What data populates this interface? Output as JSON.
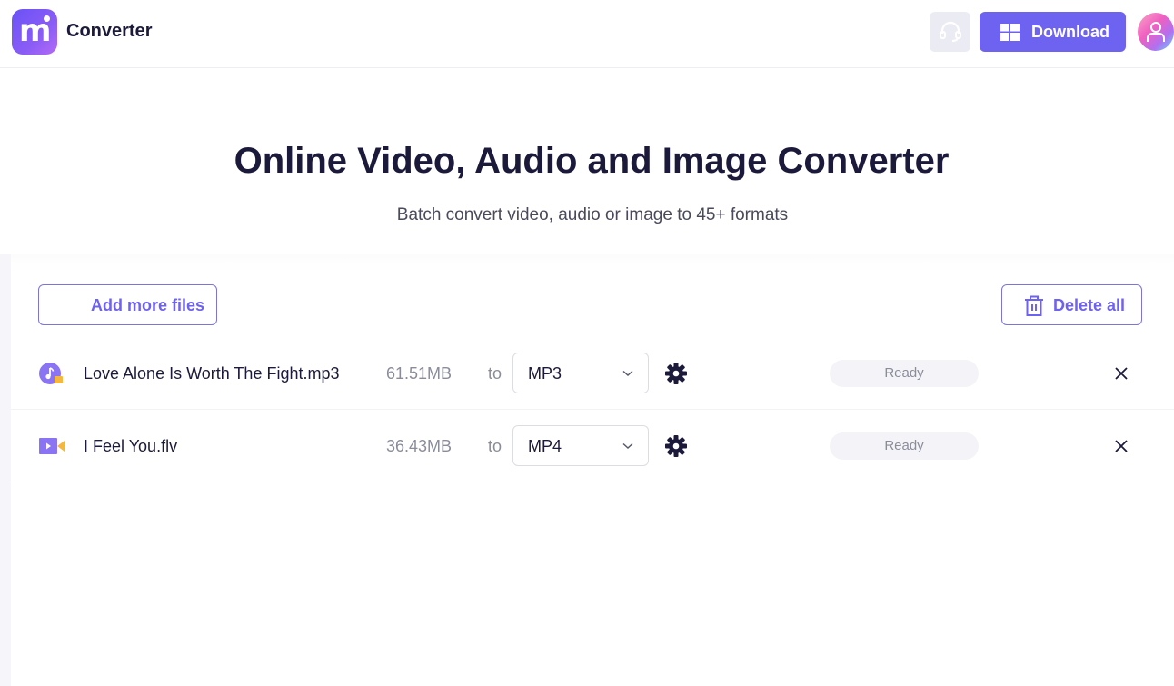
{
  "header": {
    "app_name": "Converter",
    "logo_letter": "m",
    "download_label": "Download",
    "support_icon": "headset-icon",
    "download_icon": "windows-icon",
    "avatar_icon": "user-icon"
  },
  "hero": {
    "title": "Online Video, Audio and Image Converter",
    "subtitle": "Batch convert video, audio or image to 45+ formats"
  },
  "toolbar": {
    "add_label": "Add more files",
    "delete_label": "Delete all",
    "delete_icon": "trash-icon"
  },
  "files": [
    {
      "name": "Love Alone Is Worth The Fight.mp3",
      "type_icon": "audio-file-icon",
      "size": "61.51MB",
      "to_label": "to",
      "format": "MP3",
      "status": "Ready"
    },
    {
      "name": "I Feel You.flv",
      "type_icon": "video-file-icon",
      "size": "36.43MB",
      "to_label": "to",
      "format": "MP4",
      "status": "Ready"
    }
  ],
  "colors": {
    "accent": "#6e62f0",
    "text_dark": "#1c1a3a",
    "text_muted": "#8a8d99",
    "file_icon_purple": "#8b74f3",
    "file_icon_orange": "#f5b73f"
  }
}
